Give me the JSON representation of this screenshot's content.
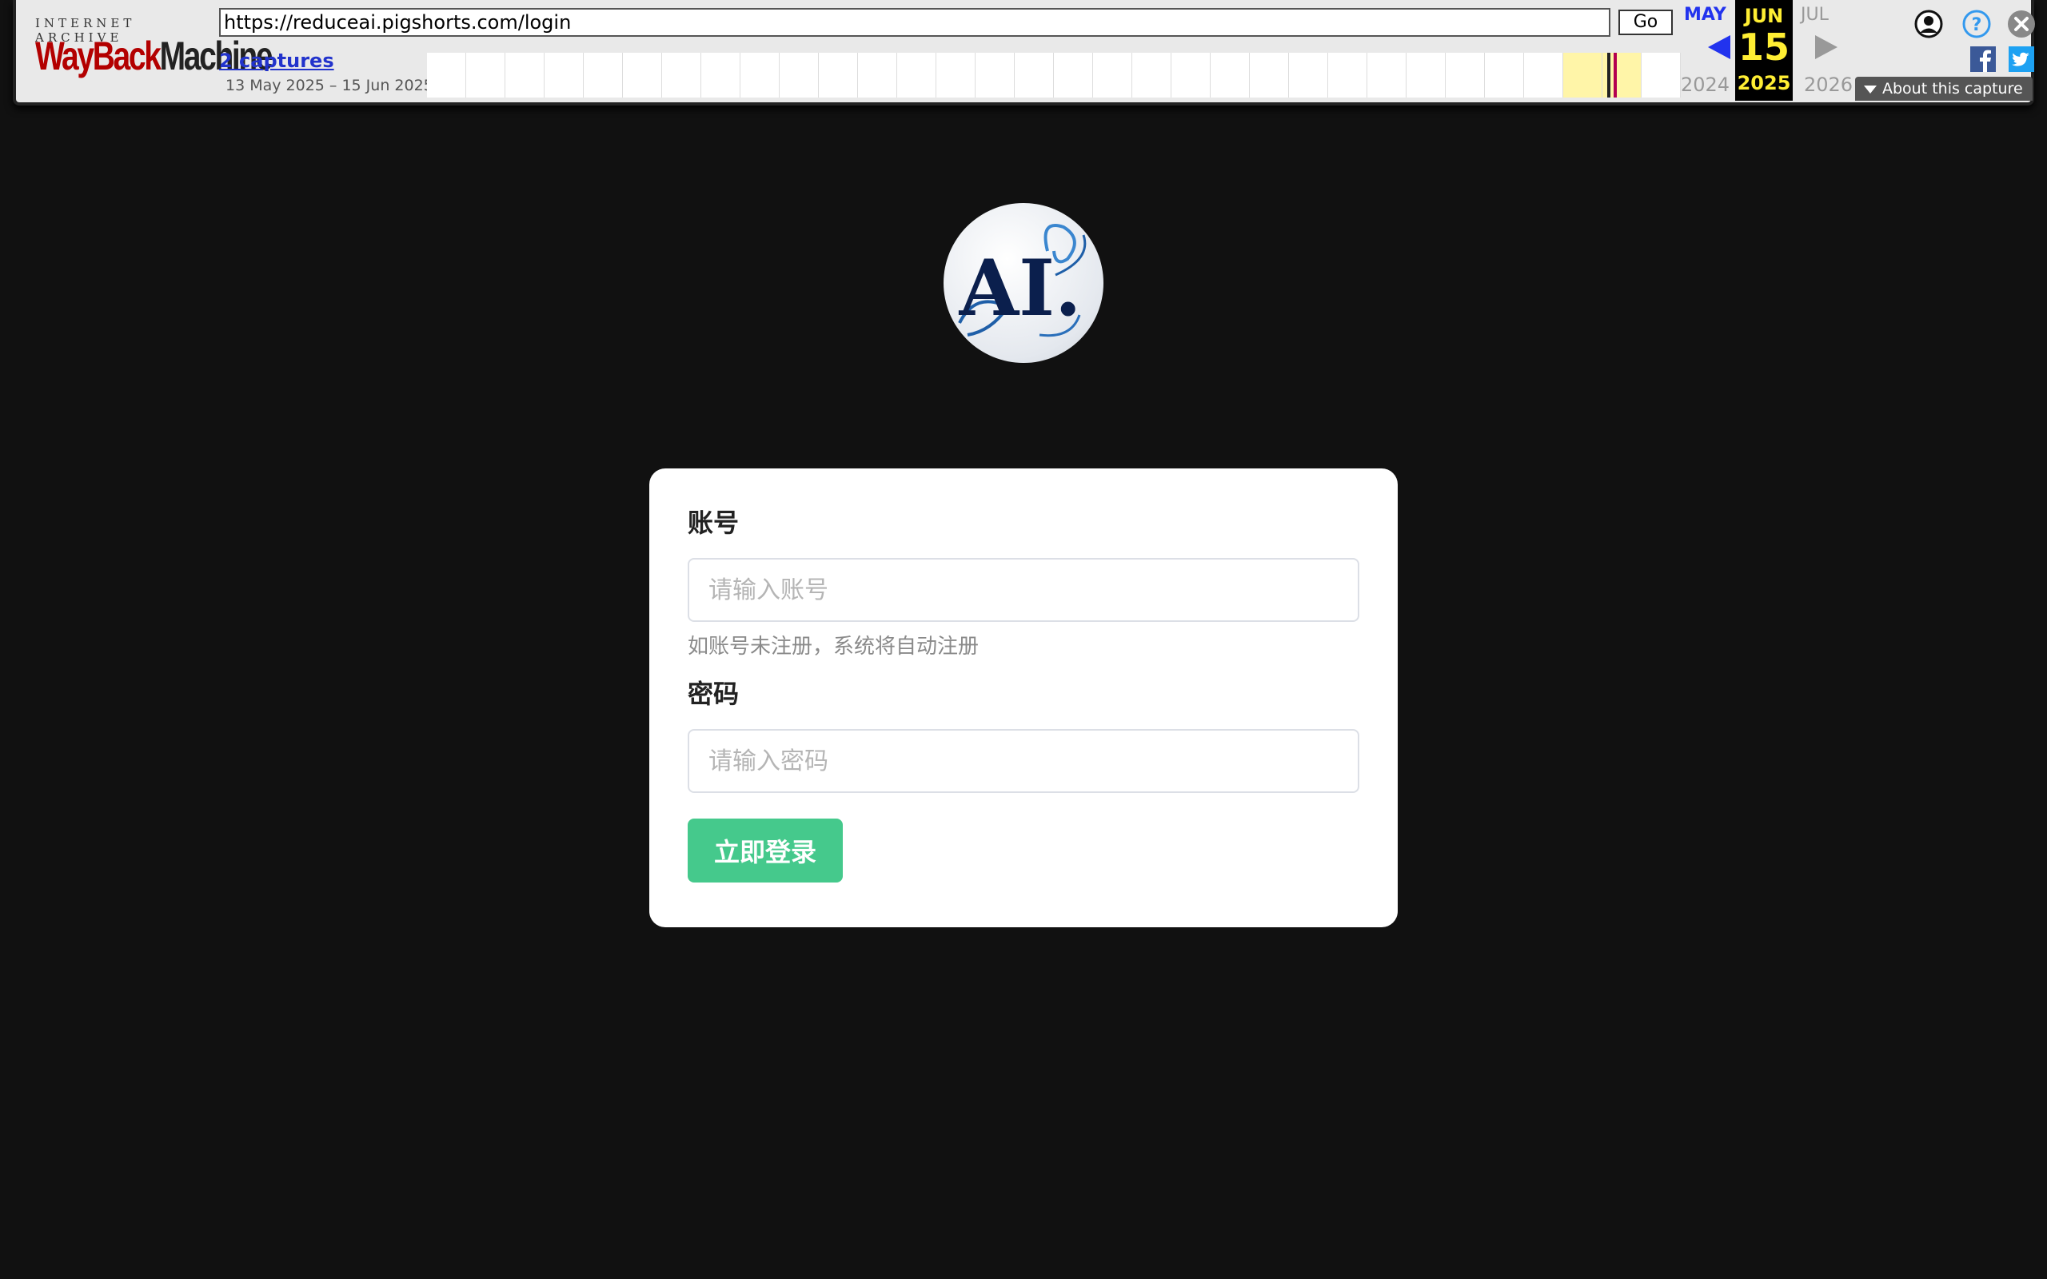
{
  "wayback": {
    "logo_top": "INTERNET ARCHIVE",
    "logo_way": "WayBack",
    "logo_machine": "Machine",
    "url": "https://reduceai.pigshorts.com/login",
    "go_label": "Go",
    "captures_label": "2 captures",
    "date_range": "13 May 2025 – 15 Jun 2025",
    "prev_month": "MAY",
    "prev_year": "2024",
    "current_month": "JUN",
    "current_day": "15",
    "current_year": "2025",
    "next_month": "JUL",
    "next_year": "2026",
    "about_label": "About this capture",
    "colors": {
      "link": "#2233cc",
      "highlight": "#ffee33",
      "arrow_active": "#2233ee",
      "arrow_inactive": "#999999"
    }
  },
  "logo": {
    "text": "AI."
  },
  "form": {
    "account_label": "账号",
    "account_placeholder": "请输入账号",
    "account_hint": "如账号未注册，系统将自动注册",
    "password_label": "密码",
    "password_placeholder": "请输入密码",
    "submit_label": "立即登录",
    "colors": {
      "submit_bg": "#45c98c",
      "card_bg": "#ffffff",
      "page_bg": "#111111"
    }
  }
}
